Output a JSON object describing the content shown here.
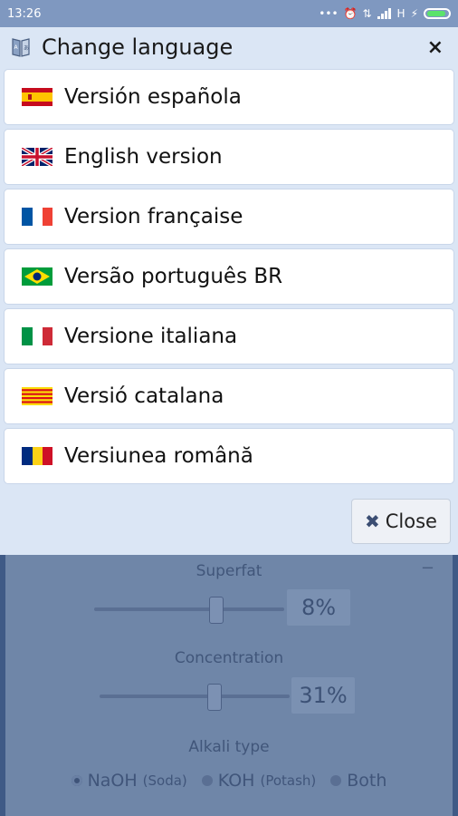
{
  "status_bar": {
    "time": "13:26",
    "network": "H"
  },
  "dialog": {
    "title": "Change language",
    "close_symbol": "×",
    "languages": [
      {
        "label": "Versión española",
        "flag": "spain"
      },
      {
        "label": "English version",
        "flag": "uk"
      },
      {
        "label": "Version française",
        "flag": "france"
      },
      {
        "label": "Versão português BR",
        "flag": "brazil"
      },
      {
        "label": "Versione italiana",
        "flag": "italy"
      },
      {
        "label": "Versió catalana",
        "flag": "catalonia"
      },
      {
        "label": "Versiunea română",
        "flag": "romania"
      }
    ],
    "close_button": {
      "icon": "✖",
      "label": "Close"
    }
  },
  "background_app": {
    "collapse_symbol": "−",
    "superfat": {
      "label": "Superfat",
      "value": "8%"
    },
    "concentration": {
      "label": "Concentration",
      "value": "31%"
    },
    "alkali_type": {
      "label": "Alkali type",
      "options": [
        {
          "label": "NaOH",
          "sub": "(Soda)",
          "selected": true
        },
        {
          "label": "KOH",
          "sub": "(Potash)",
          "selected": false
        },
        {
          "label": "Both",
          "sub": "",
          "selected": false
        }
      ]
    }
  },
  "colors": {
    "dialog_bg": "#dbe6f5",
    "status_bar": "#7f98c0",
    "battery": "#5be36b"
  }
}
